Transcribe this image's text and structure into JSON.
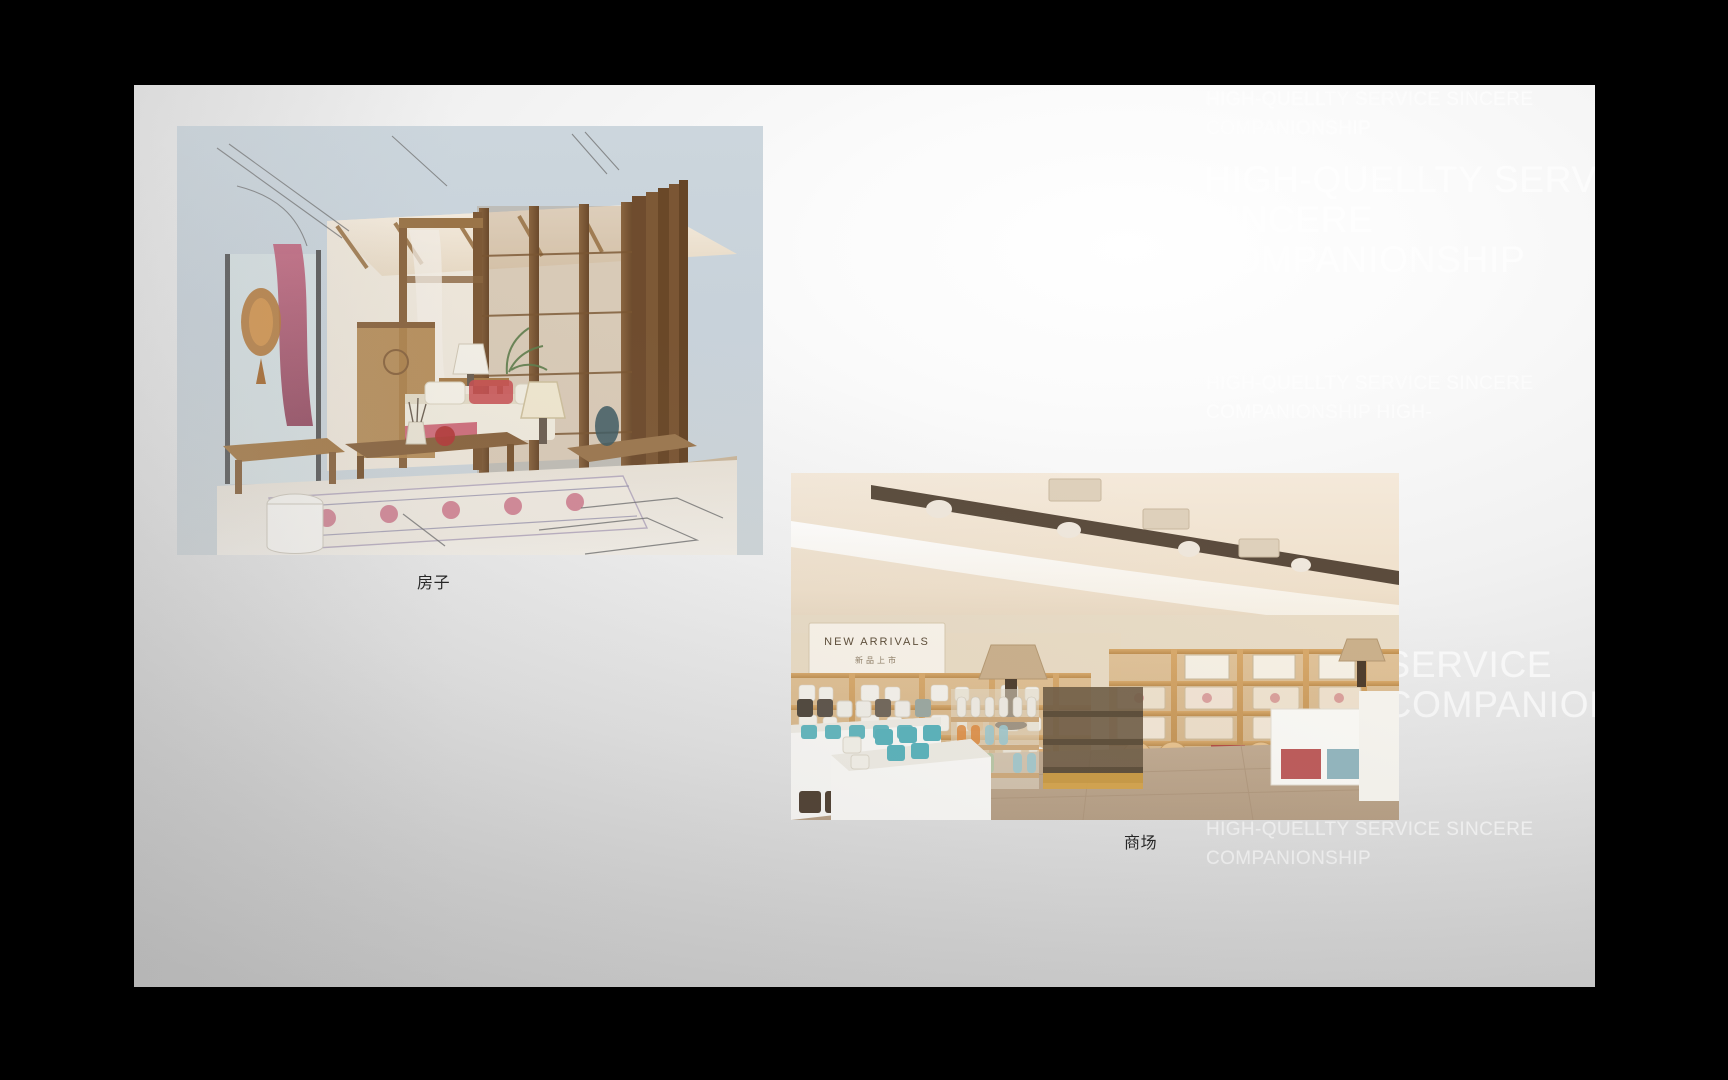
{
  "viewer": {
    "background_color": "#000000",
    "mode": "slideshow-fullscreen"
  },
  "slide": {
    "background_colors": {
      "highlight": "#ffffff",
      "mid": "#e3e3e3",
      "shadow": "#c4c4c4"
    },
    "watermark": {
      "color": "#ffffff",
      "phrase": "HIGH-QUELLTY SERVICE SINCERE COMPANIONSHIP",
      "top_block": "HIGH-QUELLTY SERVICE SINCERE COMPANIONSHIP",
      "big_block": "HIGH-QUELLTY SERVICE SINCERE COMPANIONSHIP",
      "mid_block": "HIGH-QUELLTY SERVICE SINCERE COMPANIONSHIP HIGH-",
      "lower_big_block": "QUELLTY SERVICE SINCERE COMPANIONS",
      "bottom_block": "HIGH-QUELLTY SERVICE SINCERE COMPANIONSHIP"
    },
    "images": [
      {
        "id": "house-sketch",
        "alt_label": "Traditional Chinese interior watercolor perspective sketch",
        "caption": "房子"
      },
      {
        "id": "mall-photo",
        "alt_label": "Homeware department store interior with wooden shelving",
        "caption": "商场",
        "sign_text": "NEW ARRIVALS"
      }
    ],
    "captions": {
      "house": "房子",
      "mall": "商场"
    }
  }
}
